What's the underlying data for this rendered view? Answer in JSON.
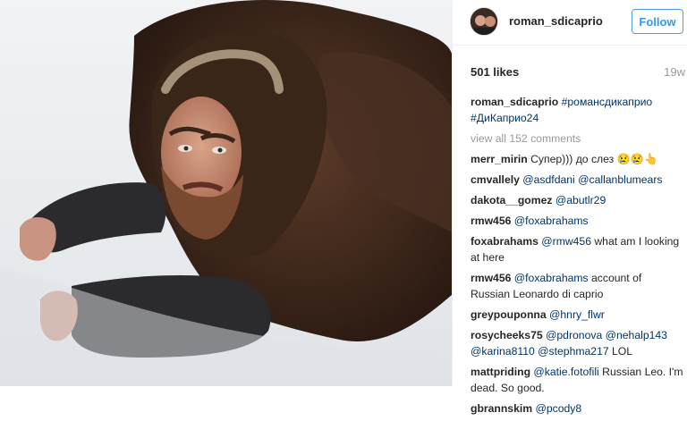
{
  "post": {
    "username": "roman_sdicaprio",
    "follow_label": "Follow",
    "likes": "501 likes",
    "time_ago": "19w",
    "caption": {
      "user": "roman_sdicaprio",
      "tags": [
        "#романсдикаприо",
        "#ДиКаприо24"
      ]
    },
    "view_all": "view all 152 comments"
  },
  "comments": [
    {
      "user": "merr_mirin",
      "segments": [
        {
          "t": "text",
          "v": "Супер))) до слез 😢😢👆"
        }
      ]
    },
    {
      "user": "cmvallely",
      "segments": [
        {
          "t": "link",
          "v": "@asdfdani"
        },
        {
          "t": "text",
          "v": " "
        },
        {
          "t": "link",
          "v": "@callanblumears"
        }
      ]
    },
    {
      "user": "dakota__gomez",
      "segments": [
        {
          "t": "link",
          "v": "@abutlr29"
        }
      ]
    },
    {
      "user": "rmw456",
      "segments": [
        {
          "t": "link",
          "v": "@foxabrahams"
        }
      ]
    },
    {
      "user": "foxabrahams",
      "segments": [
        {
          "t": "link",
          "v": "@rmw456"
        },
        {
          "t": "text",
          "v": " what am I looking at here"
        }
      ]
    },
    {
      "user": "rmw456",
      "segments": [
        {
          "t": "link",
          "v": "@foxabrahams"
        },
        {
          "t": "text",
          "v": " account of Russian Leonardo di caprio"
        }
      ]
    },
    {
      "user": "greypouponna",
      "segments": [
        {
          "t": "link",
          "v": "@hnry_flwr"
        }
      ]
    },
    {
      "user": "rosycheeks75",
      "segments": [
        {
          "t": "link",
          "v": "@pdronova"
        },
        {
          "t": "text",
          "v": " "
        },
        {
          "t": "link",
          "v": "@nehalp143"
        },
        {
          "t": "text",
          "v": " "
        },
        {
          "t": "link",
          "v": "@karina8110"
        },
        {
          "t": "text",
          "v": " "
        },
        {
          "t": "link",
          "v": "@stephma217"
        },
        {
          "t": "text",
          "v": " LOL"
        }
      ]
    },
    {
      "user": "mattpriding",
      "segments": [
        {
          "t": "link",
          "v": "@katie.fotofili"
        },
        {
          "t": "text",
          "v": " Russian Leo. I'm dead. So good."
        }
      ]
    },
    {
      "user": "gbrannskim",
      "segments": [
        {
          "t": "link",
          "v": "@pcody8"
        }
      ]
    }
  ],
  "colors": {
    "link": "#003569",
    "follow": "#3897f0",
    "muted": "#999999",
    "text": "#262626"
  }
}
